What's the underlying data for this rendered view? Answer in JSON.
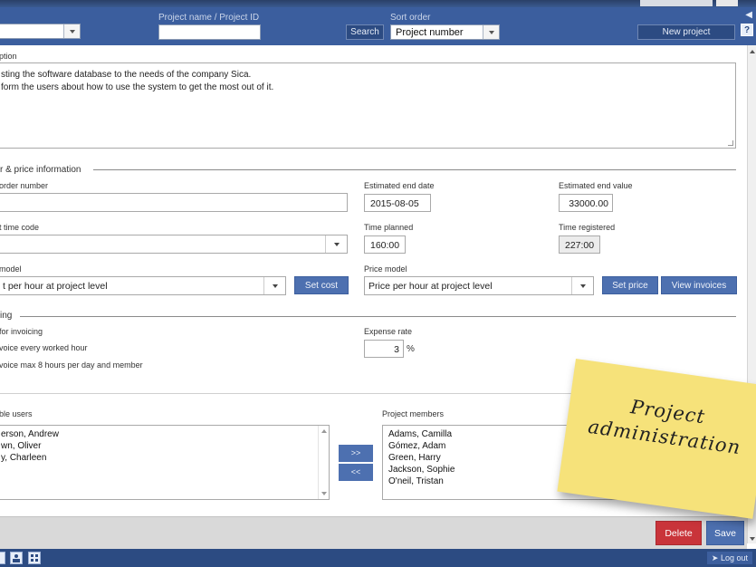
{
  "header": {
    "project_name_label": "Project name / Project ID",
    "sort_order_label": "Sort order",
    "search_button": "Search",
    "sort_order_value": "Project number",
    "new_project_button": "New project",
    "help_icon": "?"
  },
  "description": {
    "label": "ption",
    "lines": [
      "sting the software database to the needs of the company Sica.",
      "form the users about how to use the system to get the most out of it."
    ]
  },
  "order_section": {
    "title": "r & price information",
    "order_number_label": "order number",
    "order_number_value": "",
    "est_end_date_label": "Estimated end date",
    "est_end_date_value": "2015-08-05",
    "est_end_value_label": "Estimated end value",
    "est_end_value_value": "33000.00",
    "time_code_label": "t time code",
    "time_code_value": "",
    "time_planned_label": "Time planned",
    "time_planned_value": "160:00",
    "time_registered_label": "Time registered",
    "time_registered_value": "227:00",
    "cost_model_label": "model",
    "cost_model_value": "t per hour at project level",
    "set_cost_button": "Set cost",
    "price_model_label": "Price model",
    "price_model_value": "Price per hour at project level",
    "set_price_button": "Set price",
    "view_invoices_button": "View invoices"
  },
  "invoicing_section": {
    "title": "ing",
    "basis_label": "for invoicing",
    "option1": "voice every worked hour",
    "option2": "voice max 8 hours per day and member",
    "expense_rate_label": "Expense rate",
    "expense_rate_value": "3",
    "expense_rate_unit": "%"
  },
  "members": {
    "available_label": "ble users",
    "available": [
      "erson, Andrew",
      "wn, Oliver",
      "y, Charleen"
    ],
    "add_button": ">>",
    "remove_button": "<<",
    "project_members_label": "Project members",
    "project_members": [
      "Adams, Camilla",
      "Gómez, Adam",
      "Green, Harry",
      "Jackson, Sophie",
      "O'neil, Tristan"
    ]
  },
  "footer": {
    "delete_button": "Delete",
    "save_button": "Save",
    "logout_button": "Log out"
  },
  "sticky_note": {
    "line1": "Project",
    "line2": "administration"
  },
  "colors": {
    "header_bg": "#3b5e9e",
    "button_blue": "#4d70b0",
    "delete_red": "#c9343a",
    "note_yellow": "#f6e27a"
  }
}
